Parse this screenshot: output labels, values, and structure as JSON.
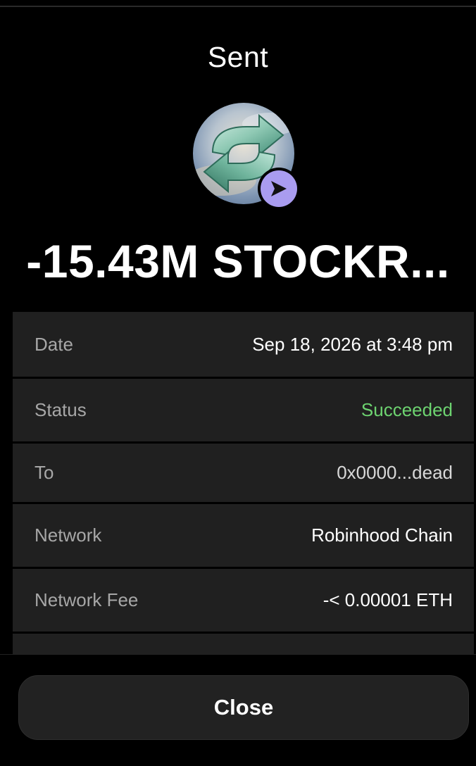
{
  "header": {
    "title": "Sent"
  },
  "token": {
    "icon": "swap-arrows-token-icon",
    "badge_icon": "send-arrow-icon",
    "badge_color": "#a99cf0"
  },
  "amount": {
    "text": "-15.43M STOCKR..."
  },
  "details": {
    "rows": [
      {
        "label": "Date",
        "value": "Sep 18, 2026 at 3:48 pm"
      },
      {
        "label": "Status",
        "value": "Succeeded"
      },
      {
        "label": "To",
        "value": "0x0000...dead"
      },
      {
        "label": "Network",
        "value": "Robinhood Chain"
      },
      {
        "label": "Network Fee",
        "value": "-< 0.00001 ETH"
      }
    ]
  },
  "colors": {
    "background": "#000000",
    "card": "#202020",
    "label": "#a7a7a7",
    "success": "#6dd370"
  },
  "footer": {
    "close_label": "Close"
  }
}
